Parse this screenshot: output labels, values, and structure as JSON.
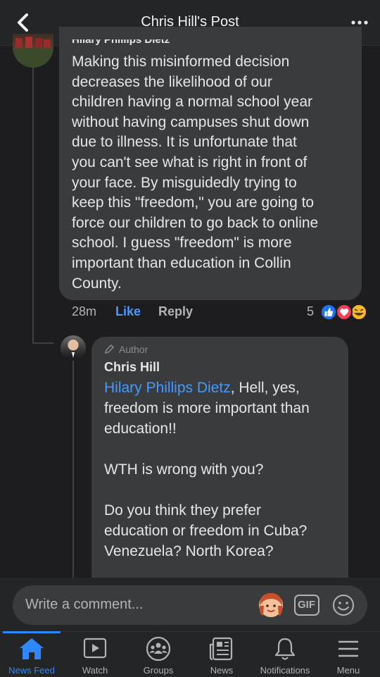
{
  "header": {
    "title": "Chris Hill's Post"
  },
  "parent_comment": {
    "author_cutoff": "Hilary Phillips Dietz",
    "lines": [
      "Making this misinformed decision",
      "decreases the likelihood of our",
      "children having a normal school year",
      "without having campuses shut down",
      "due to illness. It is unfortunate that",
      "you can't see what is right in front of",
      "your face. By misguidedly trying to",
      "keep this \"freedom,\" you are going to",
      "force our children to go back to online",
      "school. I guess \"freedom\" is more",
      "important than education in Collin",
      "County."
    ],
    "time": "28m",
    "like_label": "Like",
    "reply_label": "Reply",
    "reaction_count": "5",
    "reactions": [
      "like-icon",
      "love-icon",
      "haha-icon"
    ]
  },
  "reply": {
    "badge": "Author",
    "name": "Chris Hill",
    "mention": "Hilary Phillips Dietz",
    "text_after_mention": ", Hell, yes,",
    "line2": "freedom is more important than",
    "line3": "education!!",
    "para2": "WTH is wrong with you?",
    "para3_line1": "Do you think they prefer",
    "para3_line2": "education or freedom in Cuba?",
    "para3_line3": "Venezuela? North Korea?"
  },
  "composer": {
    "placeholder": "Write a comment...",
    "gif_label": "GIF"
  },
  "tabs": [
    {
      "label": "News Feed",
      "icon": "home-icon",
      "active": true
    },
    {
      "label": "Watch",
      "icon": "watch-icon",
      "active": false
    },
    {
      "label": "Groups",
      "icon": "groups-icon",
      "active": false
    },
    {
      "label": "News",
      "icon": "news-icon",
      "active": false
    },
    {
      "label": "Notifications",
      "icon": "bell-icon",
      "active": false
    },
    {
      "label": "Menu",
      "icon": "menu-icon",
      "active": false
    }
  ],
  "colors": {
    "background": "#1d1d1f",
    "bubble": "#3a3b3c",
    "accent": "#2d88ff",
    "link": "#4599ff"
  }
}
